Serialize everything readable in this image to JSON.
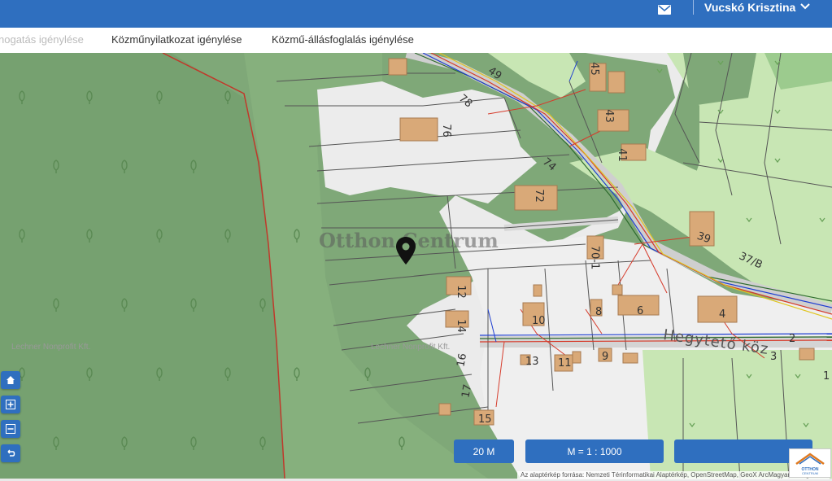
{
  "header": {
    "user_name": "Vucskó Krisztina",
    "mail_icon": "envelope-icon",
    "chevron_icon": "chevron-down-icon"
  },
  "tabs": [
    {
      "label": "nogatás igénylése",
      "active": false
    },
    {
      "label": "Közműnyilatkozat igénylése",
      "active": false
    },
    {
      "label": "Közmű-állásfoglalás igénylése",
      "active": false
    }
  ],
  "map": {
    "watermark": "Otthon Centrum",
    "street_label": "Hegytető köz",
    "copyright_left": "Lechner Nonprofit Kft.",
    "copyright_mid": "Lechner Nonprofit Kft.",
    "parcel_numbers": [
      "49",
      "78",
      "76",
      "45",
      "43",
      "41",
      "74",
      "72",
      "39",
      "37/B",
      "70-1",
      "12",
      "14",
      "16",
      "17",
      "15",
      "10",
      "8",
      "6",
      "4",
      "13",
      "11",
      "9",
      "2",
      "3",
      "1"
    ],
    "colors": {
      "forest": "#7fa878",
      "forest_light": "#a3c79b",
      "meadow": "#c8e6b4",
      "built": "#ececec",
      "building": "#d9a978",
      "parcel_line": "#555555",
      "boundary": "#c0392b"
    }
  },
  "controls": {
    "home_icon": "home-icon",
    "zoom_in_icon": "zoom-in-icon",
    "zoom_out_icon": "zoom-out-icon",
    "back_icon": "back-icon"
  },
  "footer": {
    "scale_bar": "20 M",
    "scale_ratio": "M = 1 : 1000",
    "attribution": "Az alaptérkép forrása: Nemzeti Térinformatikai Alaptérkép, OpenStreetMap, GeoX ArcMagyarorszag"
  },
  "logo": {
    "text": "OTTHON CENTRUM"
  }
}
